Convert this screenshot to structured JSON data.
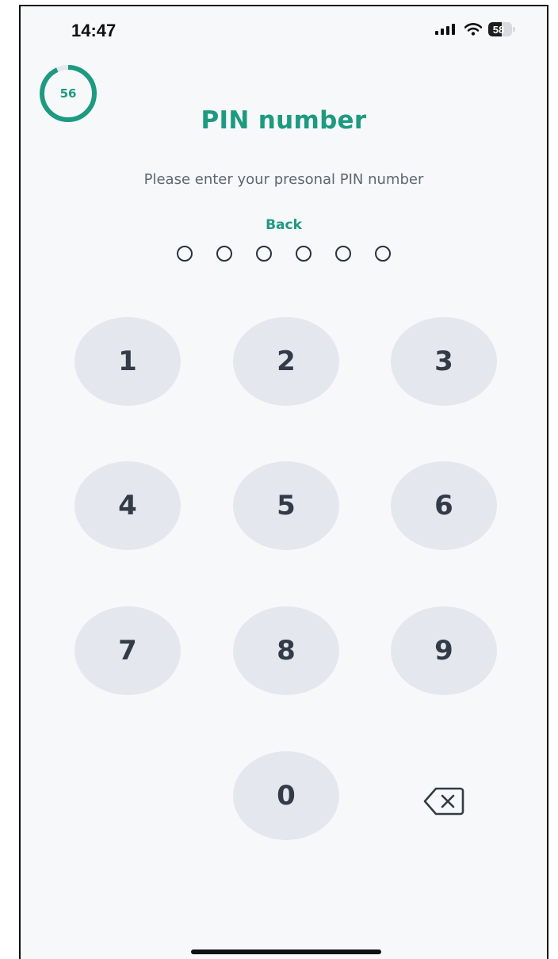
{
  "status_bar": {
    "time": "14:47",
    "battery": "58",
    "battery_level_percent": 58
  },
  "timer": {
    "value": "56",
    "progress_fraction": 0.93,
    "color": "#1d9a80"
  },
  "header": {
    "title": "PIN number",
    "subtitle": "Please enter your presonal PIN number",
    "back_label": "Back"
  },
  "pin": {
    "length": 6,
    "filled": 0
  },
  "keypad": {
    "keys": [
      "1",
      "2",
      "3",
      "4",
      "5",
      "6",
      "7",
      "8",
      "9",
      "0"
    ],
    "backspace_icon": "backspace-icon"
  },
  "colors": {
    "accent": "#1d9a80",
    "key_background": "#e4e8ee",
    "screen_background": "#f6f8fa"
  }
}
